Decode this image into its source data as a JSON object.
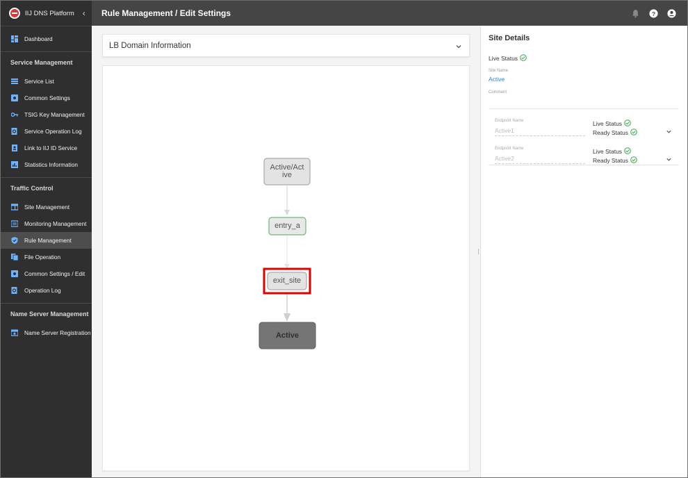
{
  "app": {
    "name": "IIJ DNS Platform"
  },
  "header": {
    "title": "Rule Management / Edit Settings"
  },
  "sidebar": {
    "top": [
      {
        "label": "Dashboard",
        "icon": "dashboard-icon"
      }
    ],
    "sections": [
      {
        "title": "Service Management",
        "items": [
          {
            "label": "Service List",
            "icon": "list-icon"
          },
          {
            "label": "Common Settings",
            "icon": "settings-icon"
          },
          {
            "label": "TSIG Key Management",
            "icon": "key-icon"
          },
          {
            "label": "Service Operation Log",
            "icon": "search-doc-icon"
          },
          {
            "label": "Link to IIJ ID Service",
            "icon": "id-badge-icon"
          },
          {
            "label": "Statistics Information",
            "icon": "bar-chart-icon"
          }
        ]
      },
      {
        "title": "Traffic Control",
        "items": [
          {
            "label": "Site Management",
            "icon": "site-icon"
          },
          {
            "label": "Monitoring Management",
            "icon": "monitor-icon"
          },
          {
            "label": "Rule Management",
            "icon": "shield-check-icon",
            "active": true
          },
          {
            "label": "File Operation",
            "icon": "file-icon"
          },
          {
            "label": "Common Settings / Edit",
            "icon": "settings-icon"
          },
          {
            "label": "Operation Log",
            "icon": "search-doc-icon"
          }
        ]
      },
      {
        "title": "Name Server Management",
        "items": [
          {
            "label": "Name Server Registration",
            "icon": "server-register-icon"
          }
        ]
      }
    ]
  },
  "main": {
    "accordion_label": "LB Domain Information",
    "flow": {
      "nodes": [
        {
          "id": "n1",
          "label_line1": "Active/Act",
          "label_line2": "ive",
          "style": "default"
        },
        {
          "id": "n2",
          "label": "entry_a",
          "style": "green"
        },
        {
          "id": "n3",
          "label": "exit_site",
          "style": "selected"
        },
        {
          "id": "n4",
          "label": "Active",
          "style": "dark"
        }
      ]
    }
  },
  "panel": {
    "title": "Site Details",
    "live_status_label": "Live Status",
    "site_name_label": "Site Name",
    "site_name_value": "Active",
    "comment_label": "Comment",
    "endpoints": [
      {
        "name_label": "Endpoint Name",
        "name_value": "Active1",
        "live_label": "Live Status",
        "ready_label": "Ready Status"
      },
      {
        "name_label": "Endpoint Name",
        "name_value": "Active2",
        "live_label": "Live Status",
        "ready_label": "Ready Status"
      }
    ]
  },
  "colors": {
    "sidebar_bg": "#2f2f2f",
    "header_bg": "#454545",
    "status_ok": "#3aa64a",
    "link": "#2b7fd1",
    "selected_outline": "#e00000"
  }
}
